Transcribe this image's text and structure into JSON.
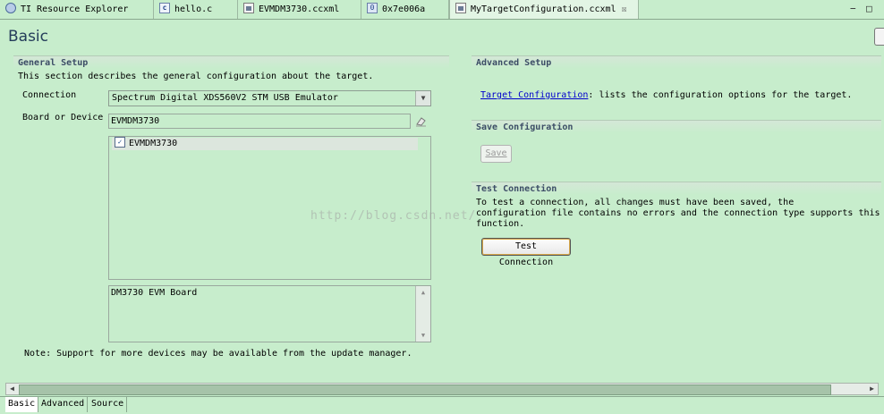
{
  "tabs": [
    {
      "label": "TI Resource Explorer",
      "icon": "globe-icon"
    },
    {
      "label": "hello.c",
      "icon": "c-file-icon"
    },
    {
      "label": "EVMDM3730.ccxml",
      "icon": "ccxml-file-icon"
    },
    {
      "label": "0x7e006a",
      "icon": "memory-view-icon"
    },
    {
      "label": "MyTargetConfiguration.ccxml",
      "icon": "ccxml-file-icon",
      "active": true,
      "close": "☒"
    }
  ],
  "window_controls": {
    "minimize": "−",
    "maximize": "□"
  },
  "page": {
    "title": "Basic"
  },
  "general_setup": {
    "header": "General Setup",
    "description": "This section describes the general configuration about the target.",
    "connection_label": "Connection",
    "connection_value": "Spectrum Digital XDS560V2 STM USB Emulator",
    "board_label": "Board or Device",
    "board_value": "EVMDM3730",
    "device_list": [
      {
        "label": "EVMDM3730",
        "checked": true
      }
    ],
    "device_description": "DM3730 EVM Board",
    "note": "Note: Support for more devices may be available from the update manager."
  },
  "advanced_setup": {
    "header": "Advanced Setup",
    "link_text": "Target Configuration",
    "link_suffix": ": lists the configuration options for the target."
  },
  "save_configuration": {
    "header": "Save Configuration",
    "button": "Save"
  },
  "test_connection": {
    "header": "Test Connection",
    "line1": "To test a connection, all changes must have been saved, the",
    "line2": "configuration file contains no errors and the connection type supports this",
    "line3": "function.",
    "button": "Test Connection"
  },
  "watermark": "http://blog.csdn.net/",
  "bottom_tabs": [
    "Basic",
    "Advanced",
    "Source"
  ],
  "colors": {
    "background": "#c7edcc",
    "link": "#0000cc",
    "section_header_text": "#3c4d66"
  }
}
